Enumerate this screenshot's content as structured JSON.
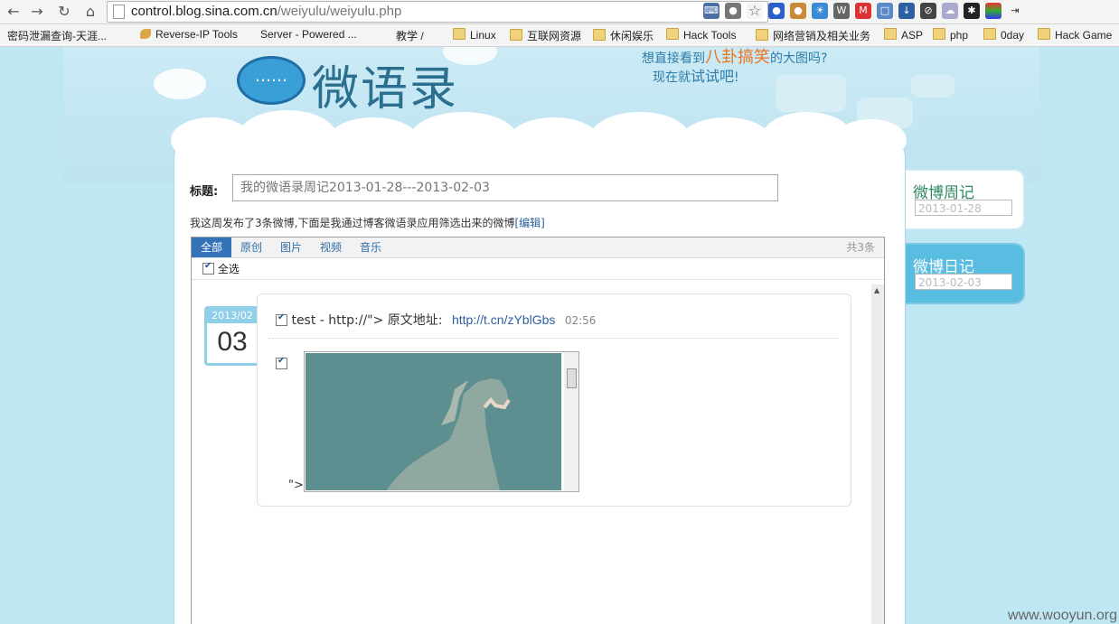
{
  "browser": {
    "back_icon": "back-arrow-icon",
    "forward_icon": "forward-arrow-icon",
    "reload_icon": "reload-icon",
    "home_icon": "home-icon",
    "url_host": "control.blog.sina.com.cn",
    "url_path": "/weiyulu/weiyulu.php"
  },
  "bookmarks": [
    {
      "label": "密码泄漏查询-天涯...",
      "icon": "page"
    },
    {
      "label": "Reverse-IP Tools",
      "icon": "tool"
    },
    {
      "label": "Server - Powered ...",
      "icon": "page"
    },
    {
      "label": "教学 /",
      "icon": "page"
    },
    {
      "label": "Linux",
      "icon": "folder"
    },
    {
      "label": "互联网资源",
      "icon": "folder"
    },
    {
      "label": "休闲娱乐",
      "icon": "folder"
    },
    {
      "label": "Hack Tools",
      "icon": "folder"
    },
    {
      "label": "网络营销及相关业务",
      "icon": "folder"
    },
    {
      "label": "ASP",
      "icon": "folder"
    },
    {
      "label": "php",
      "icon": "folder"
    },
    {
      "label": "0day",
      "icon": "folder"
    },
    {
      "label": "Hack Game",
      "icon": "folder"
    }
  ],
  "header": {
    "logo_bubble": "……",
    "logo_text": "微语录",
    "promo_line1_a": "想直接看到",
    "promo_line1_hl": "八卦搞笑",
    "promo_line1_b": "的大图吗?",
    "promo_line2_a": "现在就",
    "promo_line2_big": "试试吧",
    "promo_line2_b": "!"
  },
  "form": {
    "title_label": "标题:",
    "title_placeholder": "我的微语录周记2013-01-28---2013-02-03",
    "intro_text": "我这周发布了3条微博,下面是我通过博客微语录应用筛选出来的微博",
    "intro_edit": "[编辑]"
  },
  "list": {
    "tabs": [
      "全部",
      "原创",
      "图片",
      "视频",
      "音乐"
    ],
    "active_tab": 0,
    "count": "共3条",
    "select_all": "全选"
  },
  "post": {
    "date_ym": "2013/02",
    "date_day": "03",
    "text": "test - http://\"> 原文地址:",
    "link": "http://t.cn/zYblGbs",
    "time": "02:56",
    "trailing": "\">"
  },
  "sidebar": {
    "week_title": "微博周记",
    "week_date": "2013-01-28",
    "day_title": "微博日记",
    "day_date": "2013-02-03"
  },
  "watermark": "www.wooyun.org",
  "colors": {
    "page_bg": "#bfe6f3",
    "accent_blue": "#3473b7",
    "link": "#2c5f9e",
    "promo_highlight": "#e87620",
    "badge": "#8fd0e8"
  }
}
